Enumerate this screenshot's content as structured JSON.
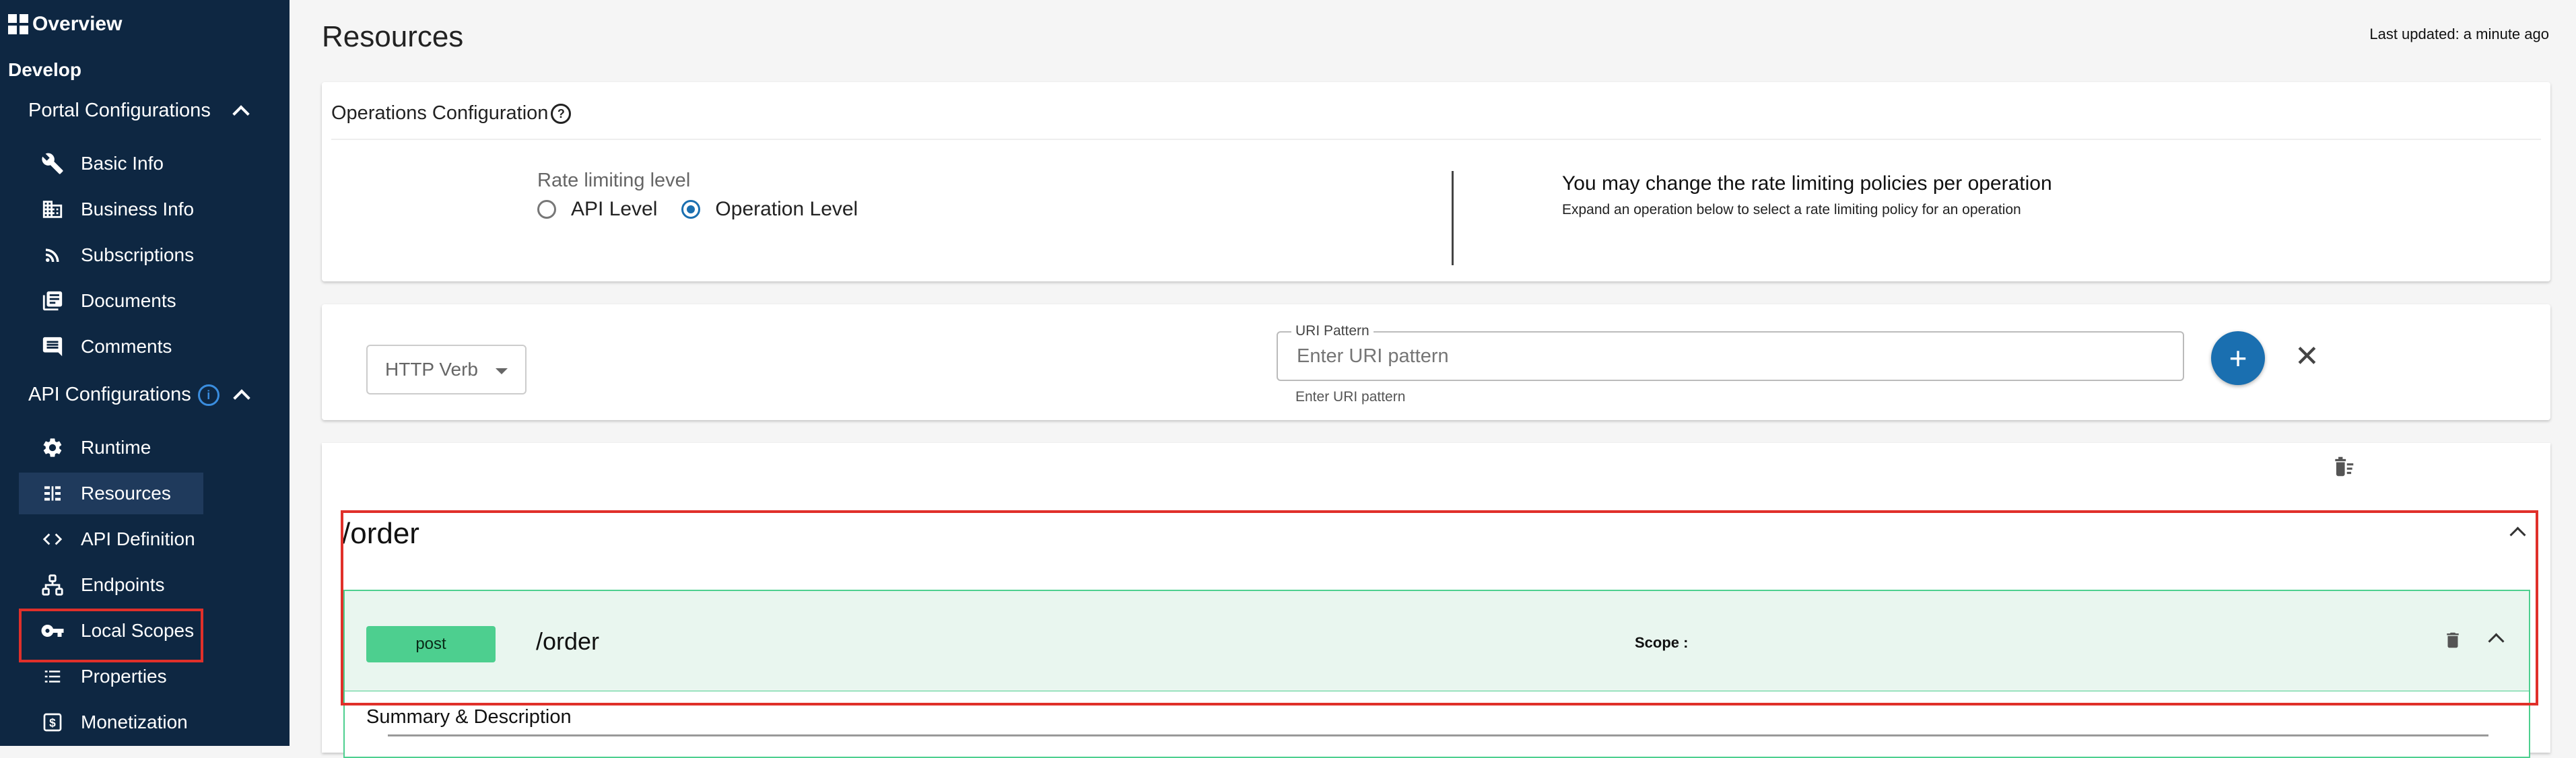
{
  "sidebar": {
    "overview": "Overview",
    "develop": "Develop",
    "portal_group": "Portal Configurations",
    "portal_items": [
      {
        "label": "Basic Info",
        "icon": "wrench-icon"
      },
      {
        "label": "Business Info",
        "icon": "building-icon"
      },
      {
        "label": "Subscriptions",
        "icon": "rss-icon"
      },
      {
        "label": "Documents",
        "icon": "library-books-icon"
      },
      {
        "label": "Comments",
        "icon": "comment-icon"
      }
    ],
    "api_group": "API Configurations",
    "api_items": [
      {
        "label": "Runtime",
        "icon": "gear-icon"
      },
      {
        "label": "Resources",
        "icon": "list-icon"
      },
      {
        "label": "API Definition",
        "icon": "code-icon"
      },
      {
        "label": "Endpoints",
        "icon": "hub-icon"
      },
      {
        "label": "Local Scopes",
        "icon": "key-icon"
      },
      {
        "label": "Properties",
        "icon": "list-bullets-icon"
      },
      {
        "label": "Monetization",
        "icon": "dollar-icon"
      }
    ],
    "active_item": "Resources"
  },
  "main": {
    "title": "Resources",
    "last_updated": "Last updated: a minute ago"
  },
  "operations_config": {
    "title": "Operations Configuration",
    "rate_limiting_label": "Rate limiting level",
    "options": [
      "API Level",
      "Operation Level"
    ],
    "selected": "Operation Level",
    "info_title": "You may change the rate limiting policies per operation",
    "info_sub": "Expand an operation below to select a rate limiting policy for an operation"
  },
  "add_resource": {
    "verb_placeholder": "HTTP Verb",
    "uri_label": "URI Pattern",
    "uri_placeholder": "Enter URI pattern",
    "uri_help": "Enter URI pattern",
    "add_symbol": "+",
    "clear_symbol": "✕"
  },
  "resource_group": {
    "path": "/order",
    "operation": {
      "method": "post",
      "path": "/order",
      "scope_label": "Scope :",
      "summary_label": "Summary & Description"
    }
  },
  "colors": {
    "sidebar_bg": "#0e2742",
    "accent": "#1a6fb0",
    "post_green": "#4dcf8f",
    "highlight_red": "#e0302a"
  }
}
